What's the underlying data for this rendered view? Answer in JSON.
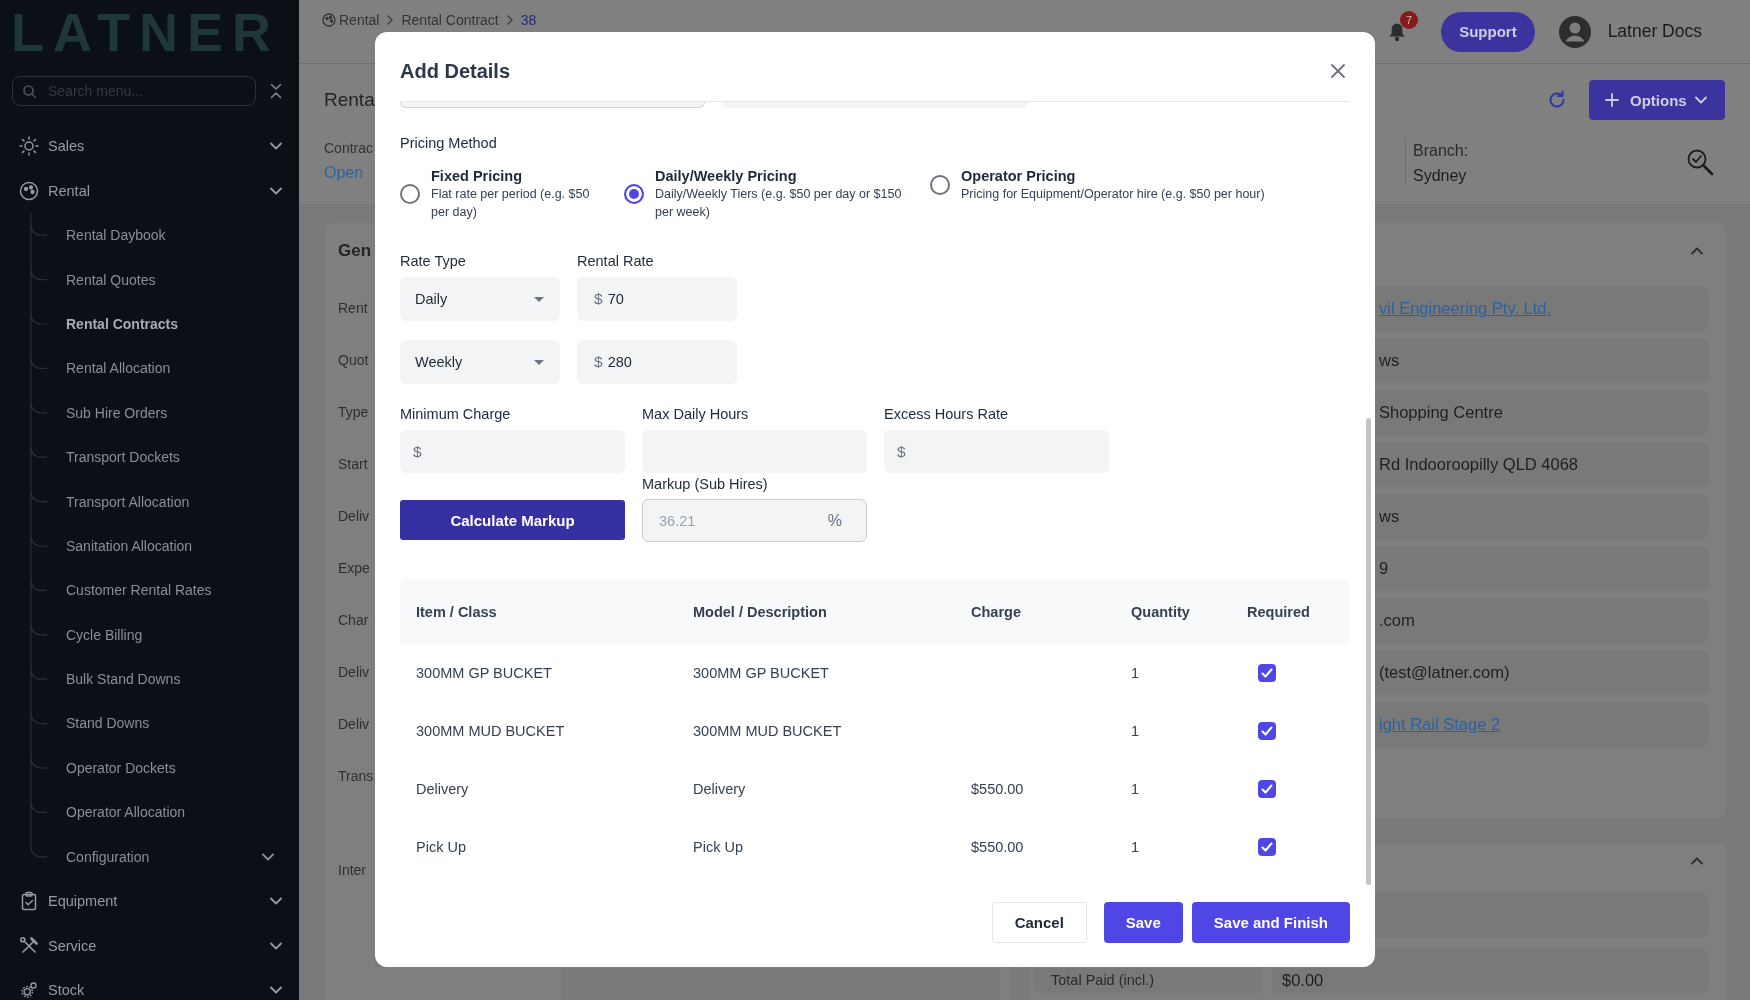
{
  "sidebar": {
    "logo": "LATNER",
    "search": {
      "placeholder": "Search menu..."
    },
    "items": [
      {
        "label": "Sales"
      },
      {
        "label": "Rental",
        "children": [
          {
            "label": "Rental Daybook",
            "kind": "link",
            "selected": false
          },
          {
            "label": "Rental Quotes",
            "kind": "link",
            "selected": false
          },
          {
            "label": "Rental Contracts",
            "kind": "link",
            "selected": true
          },
          {
            "label": "Rental Allocation",
            "kind": "link",
            "selected": false
          },
          {
            "label": "Sub Hire Orders",
            "kind": "link",
            "selected": false
          },
          {
            "label": "Transport Dockets",
            "kind": "link",
            "selected": false
          },
          {
            "label": "Transport Allocation",
            "kind": "link",
            "selected": false
          },
          {
            "label": "Sanitation Allocation",
            "kind": "link",
            "selected": false
          },
          {
            "label": "Customer Rental Rates",
            "kind": "link",
            "selected": false
          },
          {
            "label": "Cycle Billing",
            "kind": "link",
            "selected": false
          },
          {
            "label": "Bulk Stand Downs",
            "kind": "link",
            "selected": false
          },
          {
            "label": "Stand Downs",
            "kind": "link",
            "selected": false
          },
          {
            "label": "Operator Dockets",
            "kind": "link",
            "selected": false
          },
          {
            "label": "Operator Allocation",
            "kind": "link",
            "selected": false
          },
          {
            "label": "Configuration",
            "kind": "group",
            "selected": false
          }
        ]
      },
      {
        "label": "Equipment"
      },
      {
        "label": "Service"
      },
      {
        "label": "Stock"
      }
    ]
  },
  "header": {
    "breadcrumb": [
      "Rental",
      "Rental Contract",
      "38"
    ],
    "notifications": "7",
    "support_button": "Support",
    "user": "Latner Docs"
  },
  "page": {
    "title": "Renta",
    "options_button": "Options",
    "status": {
      "label": "Contrac",
      "value": "Open"
    },
    "branch": {
      "label": "Branch:",
      "value": "Sydney"
    }
  },
  "general_card": {
    "title": "Gen",
    "field_labels": [
      "Rent",
      "Quot",
      "Type",
      "Start",
      "Deliv",
      "Expe",
      "Char",
      "Deliv",
      "Deliv",
      "Trans"
    ],
    "notes_label": "Inter"
  },
  "details_card": {
    "values": [
      {
        "text": "vil Engineering Pty. Ltd.",
        "kind": "link"
      },
      {
        "text": "ws",
        "kind": "text"
      },
      {
        "text": "Shopping Centre",
        "kind": "text"
      },
      {
        "text": "Rd Indooroopilly QLD 4068",
        "kind": "text"
      },
      {
        "text": "ws",
        "kind": "text"
      },
      {
        "text": "9",
        "kind": "text"
      },
      {
        "text": ".com",
        "kind": "text"
      },
      {
        "text": "(test@latner.com)",
        "kind": "text"
      },
      {
        "text": "ight Rail Stage 2",
        "kind": "link"
      }
    ]
  },
  "totals_card": {
    "label": "Total Paid (incl.)",
    "value": "$0.00"
  },
  "modal": {
    "title": "Add Details",
    "pricing_method": {
      "label": "Pricing Method",
      "options": [
        {
          "title": "Fixed Pricing",
          "description": "Flat rate per period (e.g. $50 per day)",
          "selected": false
        },
        {
          "title": "Daily/Weekly Pricing",
          "description": "Daily/Weekly Tiers (e.g. $50 per day or $150 per week)",
          "selected": true
        },
        {
          "title": "Operator Pricing",
          "description": "Pricing for Equipment/Operator hire (e.g. $50 per hour)",
          "selected": false
        }
      ]
    },
    "rates": {
      "rate_type_label": "Rate Type",
      "rental_rate_label": "Rental Rate",
      "rows": [
        {
          "rate_type": "Daily",
          "currency": "$",
          "rate": "70"
        },
        {
          "rate_type": "Weekly",
          "currency": "$",
          "rate": "280"
        }
      ]
    },
    "charges": [
      {
        "label": "Minimum Charge",
        "prefix": "$"
      },
      {
        "label": "Max Daily Hours"
      },
      {
        "label": "Excess Hours Rate",
        "prefix": "$"
      }
    ],
    "calculate_button": "Calculate Markup",
    "markup": {
      "label": "Markup (Sub Hires)",
      "value": "36.21",
      "suffix": "%",
      "disabled": true
    },
    "table": {
      "columns": [
        "Item / Class",
        "Model / Description",
        "Charge",
        "Quantity",
        "Required"
      ],
      "rows": [
        {
          "item": "300MM GP BUCKET",
          "model": "300MM GP BUCKET",
          "quantity": "1",
          "required": true
        },
        {
          "item": "300MM MUD BUCKET",
          "model": "300MM MUD BUCKET",
          "quantity": "1",
          "required": true
        },
        {
          "item": "Delivery",
          "model": "Delivery",
          "charge": "$550.00",
          "quantity": "1",
          "required": true
        },
        {
          "item": "Pick Up",
          "model": "Pick Up",
          "charge": "$550.00",
          "quantity": "1",
          "required": true
        }
      ]
    },
    "buttons": [
      {
        "label": "Cancel",
        "kind": "secondary"
      },
      {
        "label": "Save",
        "kind": "primary"
      },
      {
        "label": "Save and Finish",
        "kind": "primary"
      }
    ]
  }
}
